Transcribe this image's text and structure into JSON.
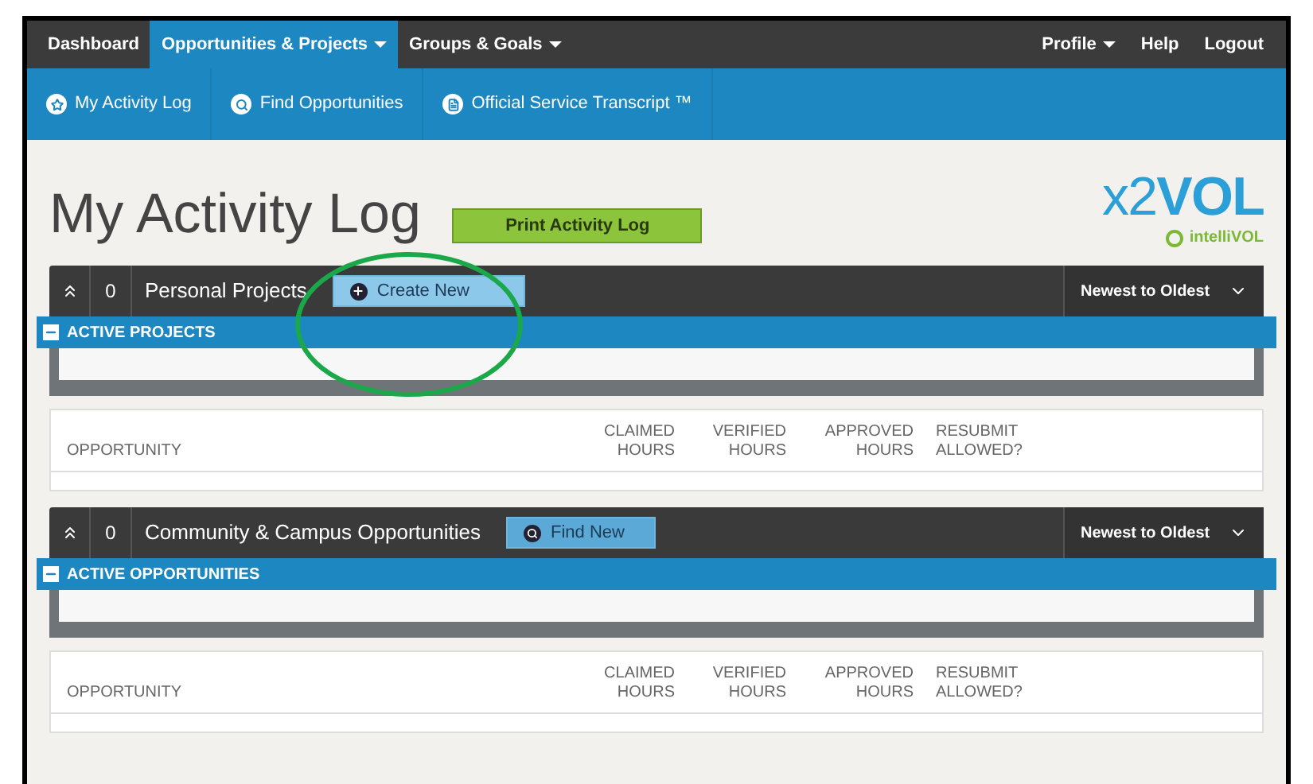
{
  "nav": {
    "left": [
      {
        "label": "Dashboard",
        "selected": false,
        "dropdown": false
      },
      {
        "label": "Opportunities & Projects",
        "selected": true,
        "dropdown": true
      },
      {
        "label": "Groups & Goals",
        "selected": false,
        "dropdown": true
      }
    ],
    "right": [
      {
        "label": "Profile",
        "dropdown": true
      },
      {
        "label": "Help",
        "dropdown": false
      },
      {
        "label": "Logout",
        "dropdown": false
      }
    ]
  },
  "subnav": [
    {
      "label": "My Activity Log",
      "kind": "star"
    },
    {
      "label": "Find Opportunities",
      "kind": "search"
    },
    {
      "label": "Official Service Transcript ™",
      "kind": "doc"
    }
  ],
  "page": {
    "title": "My Activity Log",
    "print_button": "Print Activity Log",
    "logo": {
      "main_prefix": "x2",
      "main": "VOL",
      "sub": "intelliVOL"
    }
  },
  "sections": [
    {
      "count": "0",
      "title": "Personal Projects",
      "button": {
        "label": "Create New",
        "kind": "create"
      },
      "sort": "Newest to Oldest",
      "bar": "ACTIVE PROJECTS",
      "expanded": true,
      "columns": [
        "OPPORTUNITY",
        "CLAIMED HOURS",
        "VERIFIED HOURS",
        "APPROVED HOURS",
        "RESUBMIT ALLOWED?"
      ]
    },
    {
      "count": "0",
      "title": "Community & Campus Opportunities",
      "button": {
        "label": "Find New",
        "kind": "find"
      },
      "sort": "Newest to Oldest",
      "bar": "ACTIVE OPPORTUNITIES",
      "expanded": true,
      "columns": [
        "OPPORTUNITY",
        "CLAIMED HOURS",
        "VERIFIED HOURS",
        "APPROVED HOURS",
        "RESUBMIT ALLOWED?"
      ]
    }
  ],
  "annotation": {
    "kind": "ellipse",
    "color": "#1aa84a"
  }
}
